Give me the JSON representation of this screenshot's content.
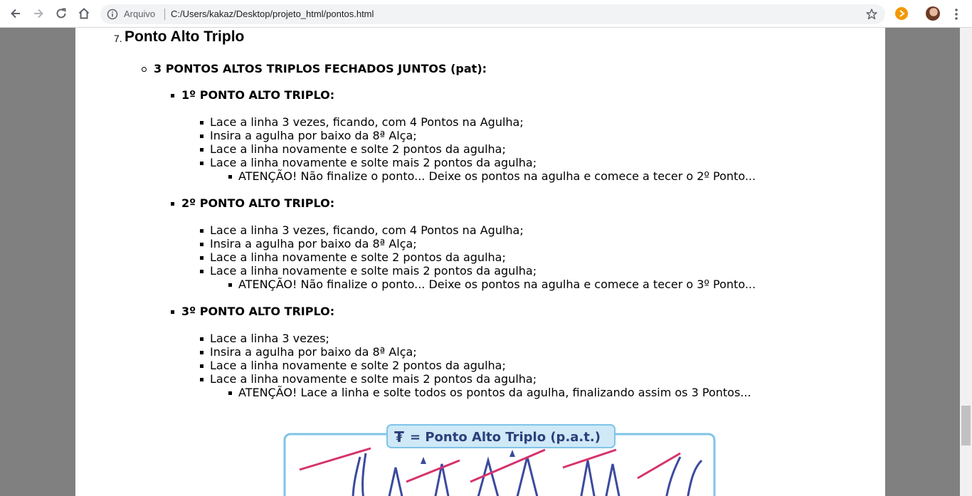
{
  "browser": {
    "address_label": "Arquivo",
    "url": "C:/Users/kakaz/Desktop/projeto_html/pontos.html",
    "icons": [
      "back-icon",
      "forward-icon",
      "reload-icon",
      "home-icon",
      "info-icon",
      "star-icon",
      "extension-icon",
      "avatar",
      "menu-icon"
    ]
  },
  "page": {
    "item_number": "7.",
    "heading": "Ponto Alto Triplo",
    "subheading": "3 PONTOS ALTOS TRIPLOS FECHADOS JUNTOS (pat):",
    "sections": [
      {
        "title": "1º PONTO ALTO TRIPLO:",
        "steps": [
          "Lace a linha 3 vezes, ficando, com 4 Pontos na Agulha;",
          "Insira a agulha por baixo da 8ª Alça;",
          "Lace a linha novamente e solte 2 pontos da agulha;",
          "Lace a linha novamente e solte mais 2 pontos da agulha;"
        ],
        "note": "ATENÇÃO! Não finalize o ponto... Deixe os pontos na agulha e comece a tecer o 2º Ponto..."
      },
      {
        "title": "2º PONTO ALTO TRIPLO:",
        "steps": [
          "Lace a linha 3 vezes, ficando, com 4 Pontos na Agulha;",
          "Insira a agulha por baixo da 8ª Alça;",
          "Lace a linha novamente e solte 2 pontos da agulha;",
          "Lace a linha novamente e solte mais 2 pontos da agulha;"
        ],
        "note": "ATENÇÃO! Não finalize o ponto... Deixe os pontos na agulha e comece a tecer o 3º Ponto..."
      },
      {
        "title": "3º PONTO ALTO TRIPLO:",
        "steps": [
          "Lace a linha 3 vezes;",
          "Insira a agulha por baixo da 8ª Alça;",
          "Lace a linha novamente e solte 2 pontos da agulha;",
          "Lace a linha novamente e solte mais 2 pontos da agulha;"
        ],
        "note": "ATENÇÃO! Lace a linha e solte todos os pontos da agulha, finalizando assim os 3 Pontos..."
      }
    ],
    "illustration": {
      "symbol": "₮",
      "caption": "= Ponto Alto Triplo (p.a.t.)"
    }
  }
}
